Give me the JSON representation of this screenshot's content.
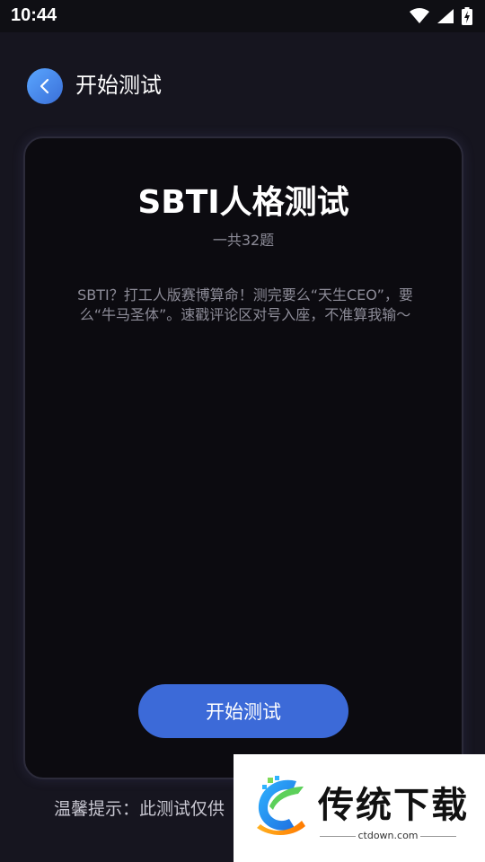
{
  "status_bar": {
    "time": "10:44",
    "icons": [
      "wifi-icon",
      "signal-icon",
      "battery-charging-icon"
    ]
  },
  "header": {
    "title": "开始测试",
    "back_icon": "chevron-left-icon"
  },
  "card": {
    "title": "SBTI人格测试",
    "count": "一共32题",
    "description": "SBTI？打工人版赛博算命！测完要么“天生CEO”，要么“牛马圣体”。速戳评论区对号入座，不准算我输～",
    "start_button_label": "开始测试"
  },
  "tip": {
    "text": "温馨提示：此测试仅供"
  },
  "watermark": {
    "title": "传统下载",
    "domain": "ctdown.com"
  },
  "colors": {
    "background": "#16151f",
    "card": "#0c0b10",
    "accent": "#3c6ad8"
  }
}
